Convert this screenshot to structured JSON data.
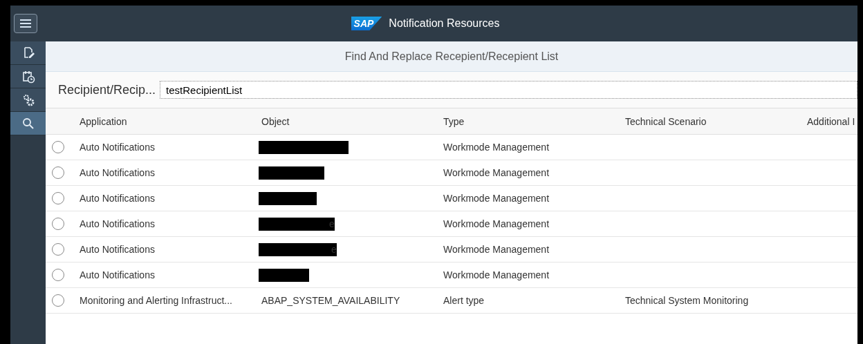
{
  "header": {
    "logo": "SAP",
    "title": "Notification Resources"
  },
  "sidebar": {
    "items": [
      {
        "selected": false
      },
      {
        "selected": false
      },
      {
        "selected": false
      },
      {
        "selected": true
      }
    ]
  },
  "page_title": "Find And Replace Recepient/Recepient List",
  "filter": {
    "label": "Recipient/Recip...",
    "value": "testRecipientList"
  },
  "table": {
    "columns": [
      "Application",
      "Object",
      "Type",
      "Technical Scenario",
      "Additional I"
    ],
    "rows": [
      {
        "selected": false,
        "application": "Auto Notifications",
        "object_redacted": true,
        "type": "Workmode Management"
      },
      {
        "selected": false,
        "application": "Auto Notifications",
        "object_redacted": true,
        "type": "Workmode Management"
      },
      {
        "selected": false,
        "application": "Auto Notifications",
        "object_redacted": true,
        "type": "Workmode Management"
      },
      {
        "selected": false,
        "application": "Auto Notifications",
        "object_redacted": true,
        "object": "e",
        "type": "Workmode Management"
      },
      {
        "selected": false,
        "application": "Auto Notifications",
        "object_redacted": true,
        "object": "e",
        "type": "Workmode Management"
      },
      {
        "selected": false,
        "application": "Auto Notifications",
        "object_redacted": true,
        "type": "Workmode Management"
      },
      {
        "selected": false,
        "application": "Monitoring and Alerting Infrastruct...",
        "object_redacted": false,
        "object": "ABAP_SYSTEM_AVAILABILITY",
        "type": "Alert type",
        "technical_scenario": "Technical System Monitoring"
      }
    ]
  }
}
